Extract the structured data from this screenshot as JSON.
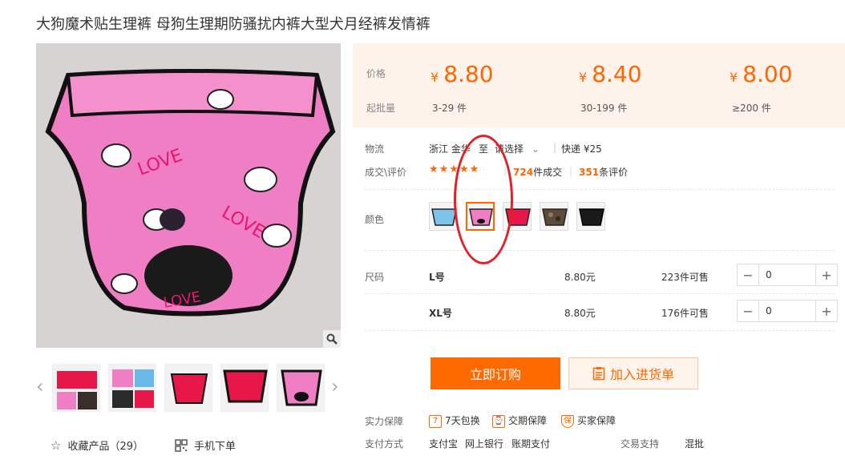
{
  "title": "大狗魔术贴生理裤 母狗生理期防骚扰内裤大型犬月经裤发情裤",
  "price": {
    "price_label": "价格",
    "moq_label": "起批量",
    "currency": "¥",
    "tiers": [
      {
        "price": "8.80",
        "range": "3-29 件"
      },
      {
        "price": "8.40",
        "range": "30-199 件"
      },
      {
        "price": "8.00",
        "range": "≥200 件"
      }
    ]
  },
  "logistics": {
    "label": "物流",
    "from": "浙江 金华",
    "to_prefix": "至",
    "select": "请选择",
    "express": "快递 ¥25"
  },
  "reviews": {
    "label": "成交\\评价",
    "stars": "★★★★★",
    "sold_count": "724",
    "sold_suffix": "件成交",
    "review_count": "351",
    "review_suffix": "条评价"
  },
  "color": {
    "label": "颜色"
  },
  "size": {
    "label": "尺码",
    "rows": [
      {
        "name": "L号",
        "price": "8.80元",
        "stock": "223件可售",
        "qty": "0"
      },
      {
        "name": "XL号",
        "price": "8.80元",
        "stock": "176件可售",
        "qty": "0"
      }
    ]
  },
  "buttons": {
    "order": "立即订购",
    "cart": "加入进货单"
  },
  "guarantee": {
    "label": "实力保障",
    "items": [
      "7天包换",
      "交期保障",
      "买家保障"
    ]
  },
  "payment": {
    "label": "支付方式",
    "methods": [
      "支付宝",
      "网上银行",
      "账期支付"
    ],
    "trade_label": "交易支持",
    "trade_value": "混批"
  },
  "bottom": {
    "favorite": "收藏产品（29）",
    "mobile": "手机下单"
  },
  "colors": {
    "accent": "#ff6600",
    "price_bg": "#fdf3ea",
    "annotation": "#e51f26"
  }
}
